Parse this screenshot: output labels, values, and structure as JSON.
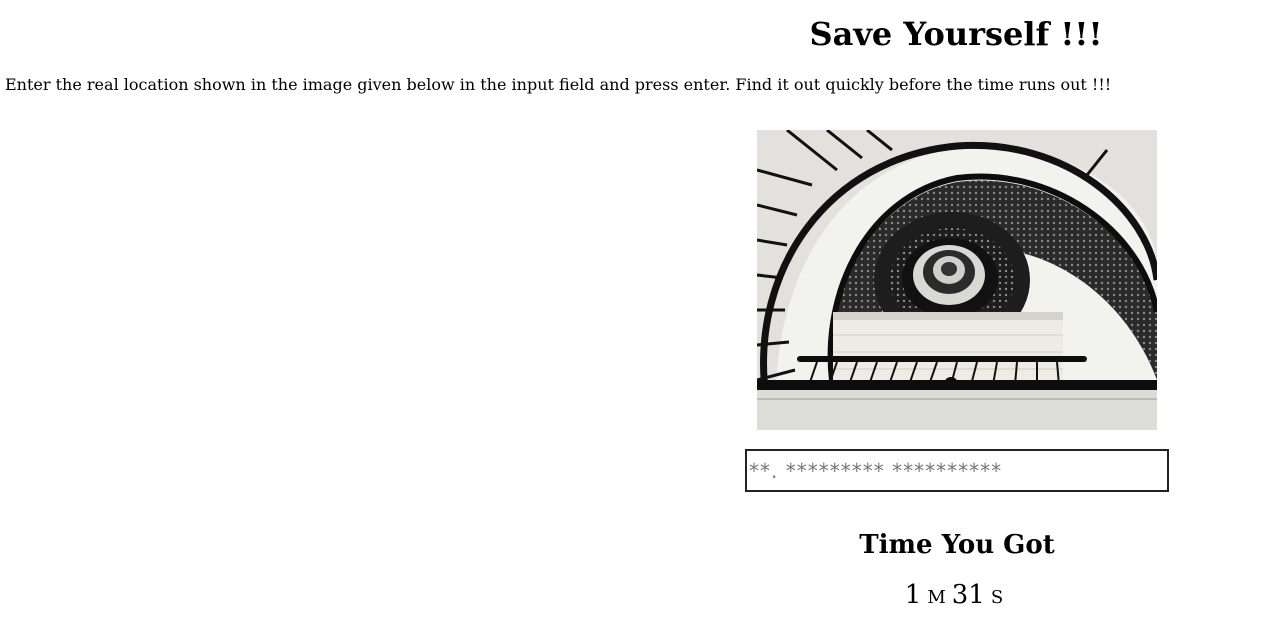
{
  "page": {
    "title": "Save Yourself !!!",
    "instructions": "Enter the real location shown in the image given below in the input field and press enter. Find it out quickly before the time runs out !!!"
  },
  "image": {
    "subject": "spiral staircase viewed from above"
  },
  "answer": {
    "value": "",
    "placeholder": "**. ********* **********"
  },
  "timer": {
    "heading": "Time You Got",
    "minutes": "1",
    "minutes_unit": "M",
    "seconds": "31",
    "seconds_unit": "S"
  }
}
